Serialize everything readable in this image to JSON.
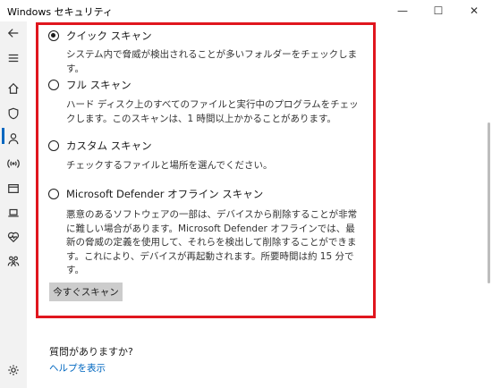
{
  "window": {
    "title": "Windows セキュリティ",
    "controls": {
      "minimize": "—",
      "maximize": "☐",
      "close": "✕"
    }
  },
  "sidebar": {
    "items": [
      {
        "icon": "back-arrow-icon",
        "active": false
      },
      {
        "icon": "menu-icon",
        "active": false
      },
      {
        "icon": "home-icon",
        "active": false
      },
      {
        "icon": "shield-icon",
        "active": true
      },
      {
        "icon": "person-icon",
        "active": false
      },
      {
        "icon": "wireless-icon",
        "active": false
      },
      {
        "icon": "browser-icon",
        "active": false
      },
      {
        "icon": "laptop-icon",
        "active": false
      },
      {
        "icon": "heart-pulse-icon",
        "active": false
      },
      {
        "icon": "family-icon",
        "active": false
      },
      {
        "icon": "gear-icon",
        "active": false
      }
    ]
  },
  "scan_options": [
    {
      "label": "クイック スキャン",
      "selected": true,
      "description": "システム内で脅威が検出されることが多いフォルダーをチェックします。"
    },
    {
      "label": "フル スキャン",
      "selected": false,
      "description": "ハード ディスク上のすべてのファイルと実行中のプログラムをチェックします。このスキャンは、1 時間以上かかることがあります。"
    },
    {
      "label": "カスタム スキャン",
      "selected": false,
      "description": "チェックするファイルと場所を選んでください。"
    },
    {
      "label": "Microsoft Defender オフライン スキャン",
      "selected": false,
      "description": "悪意のあるソフトウェアの一部は、デバイスから削除することが非常に難しい場合があります。Microsoft Defender オフラインでは、最新の脅威の定義を使用して、それらを検出して削除することができます。これにより、デバイスが再起動されます。所要時間は約 15 分です。"
    }
  ],
  "scan_button": {
    "label": "今すぐスキャン"
  },
  "help": {
    "question": "質問がありますか?",
    "link": "ヘルプを表示"
  },
  "colors": {
    "accent": "#0067c0",
    "highlight_border": "#e0161e"
  }
}
